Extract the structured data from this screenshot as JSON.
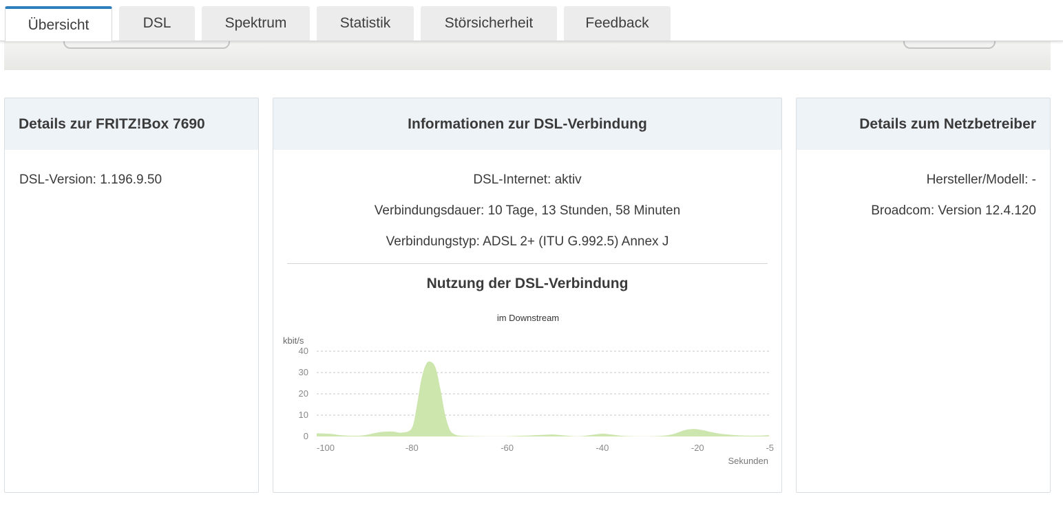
{
  "tabs": [
    {
      "label": "Übersicht",
      "active": true
    },
    {
      "label": "DSL",
      "active": false
    },
    {
      "label": "Spektrum",
      "active": false
    },
    {
      "label": "Statistik",
      "active": false
    },
    {
      "label": "Störsicherheit",
      "active": false
    },
    {
      "label": "Feedback",
      "active": false
    }
  ],
  "colors": {
    "accent": "#2d7fbd",
    "panel_header": "#eef3f8",
    "chart_fill": "#cde6ad"
  },
  "panels": {
    "fritzbox": {
      "title": "Details zur FRITZ!Box 7690",
      "dsl_version": "DSL-Version: 1.196.9.50"
    },
    "dsl": {
      "title": "Informationen zur DSL-Verbindung",
      "status": "DSL-Internet: aktiv",
      "duration": "Verbindungsdauer: 10 Tage, 13 Stunden, 58 Minuten",
      "type": "Verbindungstyp: ADSL 2+ (ITU G.992.5) Annex J",
      "usage_title": "Nutzung der DSL-Verbindung"
    },
    "provider": {
      "title": "Details zum Netzbetreiber",
      "model": "Hersteller/Modell: -",
      "broadcom": "Broadcom: Version 12.4.120"
    }
  },
  "chart_data": {
    "type": "area",
    "title": "im Downstream",
    "ylabel": "kbit/s",
    "xlabel": "Sekunden",
    "xlim": [
      -100,
      -5
    ],
    "ylim": [
      0,
      40
    ],
    "xticks": [
      "-100",
      "-80",
      "-60",
      "-40",
      "-20",
      "-5"
    ],
    "yticks": [
      "40",
      "30",
      "20",
      "10",
      "0"
    ],
    "grid": true,
    "x": [
      -100,
      -97,
      -95,
      -92,
      -90,
      -88,
      -86,
      -84,
      -82,
      -80,
      -79,
      -78,
      -77,
      -76,
      -75,
      -74,
      -73,
      -72,
      -71,
      -70,
      -68,
      -65,
      -60,
      -55,
      -52,
      -50,
      -48,
      -45,
      -42,
      -40,
      -38,
      -35,
      -30,
      -27,
      -25,
      -23,
      -21,
      -19,
      -17,
      -15,
      -12,
      -10,
      -7,
      -5
    ],
    "y": [
      1.5,
      1.2,
      0.6,
      0.3,
      0.6,
      1.5,
      2.2,
      2.3,
      1.8,
      4,
      14,
      27,
      34,
      35,
      32,
      22,
      10,
      3,
      1,
      0.4,
      0.2,
      0.1,
      0.1,
      0.5,
      0.8,
      0.9,
      0.5,
      0.1,
      0.8,
      1.3,
      0.9,
      0.2,
      0.1,
      0.4,
      1.2,
      2.8,
      3.5,
      3,
      2,
      1.2,
      0.6,
      0.4,
      0.4,
      0.6
    ]
  }
}
